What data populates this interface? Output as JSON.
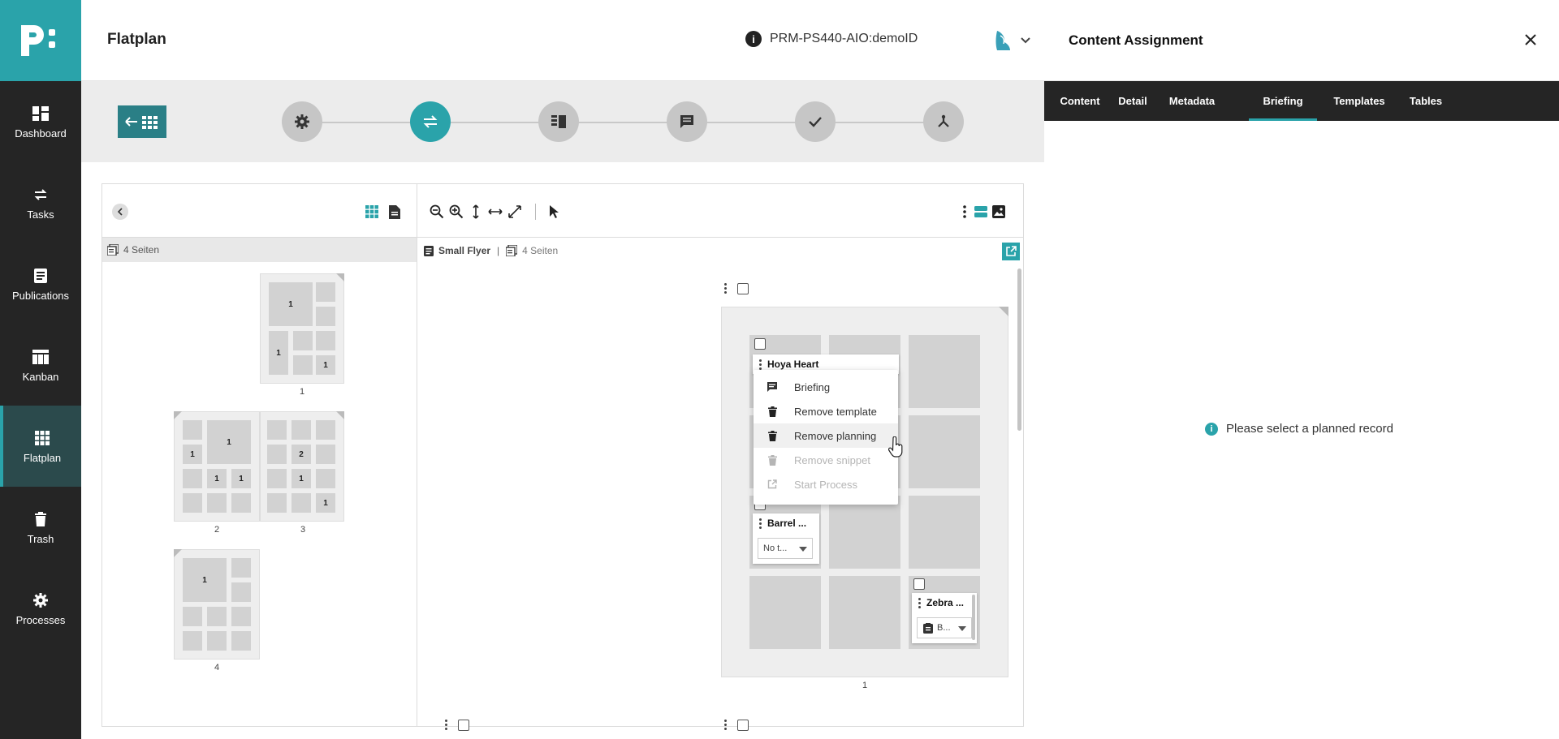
{
  "sidebar": {
    "logo_text": "p:",
    "items": [
      {
        "label": "Dashboard",
        "icon": "dashboard-icon"
      },
      {
        "label": "Tasks",
        "icon": "tasks-icon"
      },
      {
        "label": "Publications",
        "icon": "publications-icon"
      },
      {
        "label": "Kanban",
        "icon": "kanban-icon"
      },
      {
        "label": "Flatplan",
        "icon": "flatplan-icon",
        "active": true
      },
      {
        "label": "Trash",
        "icon": "trash-icon"
      },
      {
        "label": "Processes",
        "icon": "processes-icon"
      }
    ]
  },
  "header": {
    "title": "Flatplan",
    "doc_id": "PRM-PS440-AIO:demoID"
  },
  "colors": {
    "accent": "#2aa3aa",
    "sidebar_bg": "#252525",
    "active_nav_bg": "#2b4a4c"
  },
  "left_pane": {
    "pages_count_label": "4 Seiten",
    "page_labels": [
      "1",
      "2",
      "3",
      "4"
    ]
  },
  "right_pane": {
    "publication": "Small Flyer",
    "pages_count_label": "4 Seiten",
    "page_number": "1"
  },
  "cards": {
    "card1_title": "Hoya Heart",
    "card2_title": "Barrel ...",
    "card2_select": "No t...",
    "card3_title": "Zebra ...",
    "card3_select": "B..."
  },
  "context_menu": {
    "items": [
      {
        "label": "Briefing",
        "icon": "briefing-icon",
        "disabled": false
      },
      {
        "label": "Remove template",
        "icon": "trash-icon",
        "disabled": false
      },
      {
        "label": "Remove planning",
        "icon": "trash-icon",
        "disabled": false
      },
      {
        "label": "Remove snippet",
        "icon": "trash-icon",
        "disabled": true
      },
      {
        "label": "Start Process",
        "icon": "external-link-icon",
        "disabled": true
      }
    ]
  },
  "right_panel": {
    "title": "Content Assignment",
    "tabs": [
      "Content",
      "Detail",
      "Metadata",
      "Briefing",
      "Templates",
      "Tables"
    ],
    "active_tab": "Briefing",
    "empty_message": "Please select a planned record"
  }
}
